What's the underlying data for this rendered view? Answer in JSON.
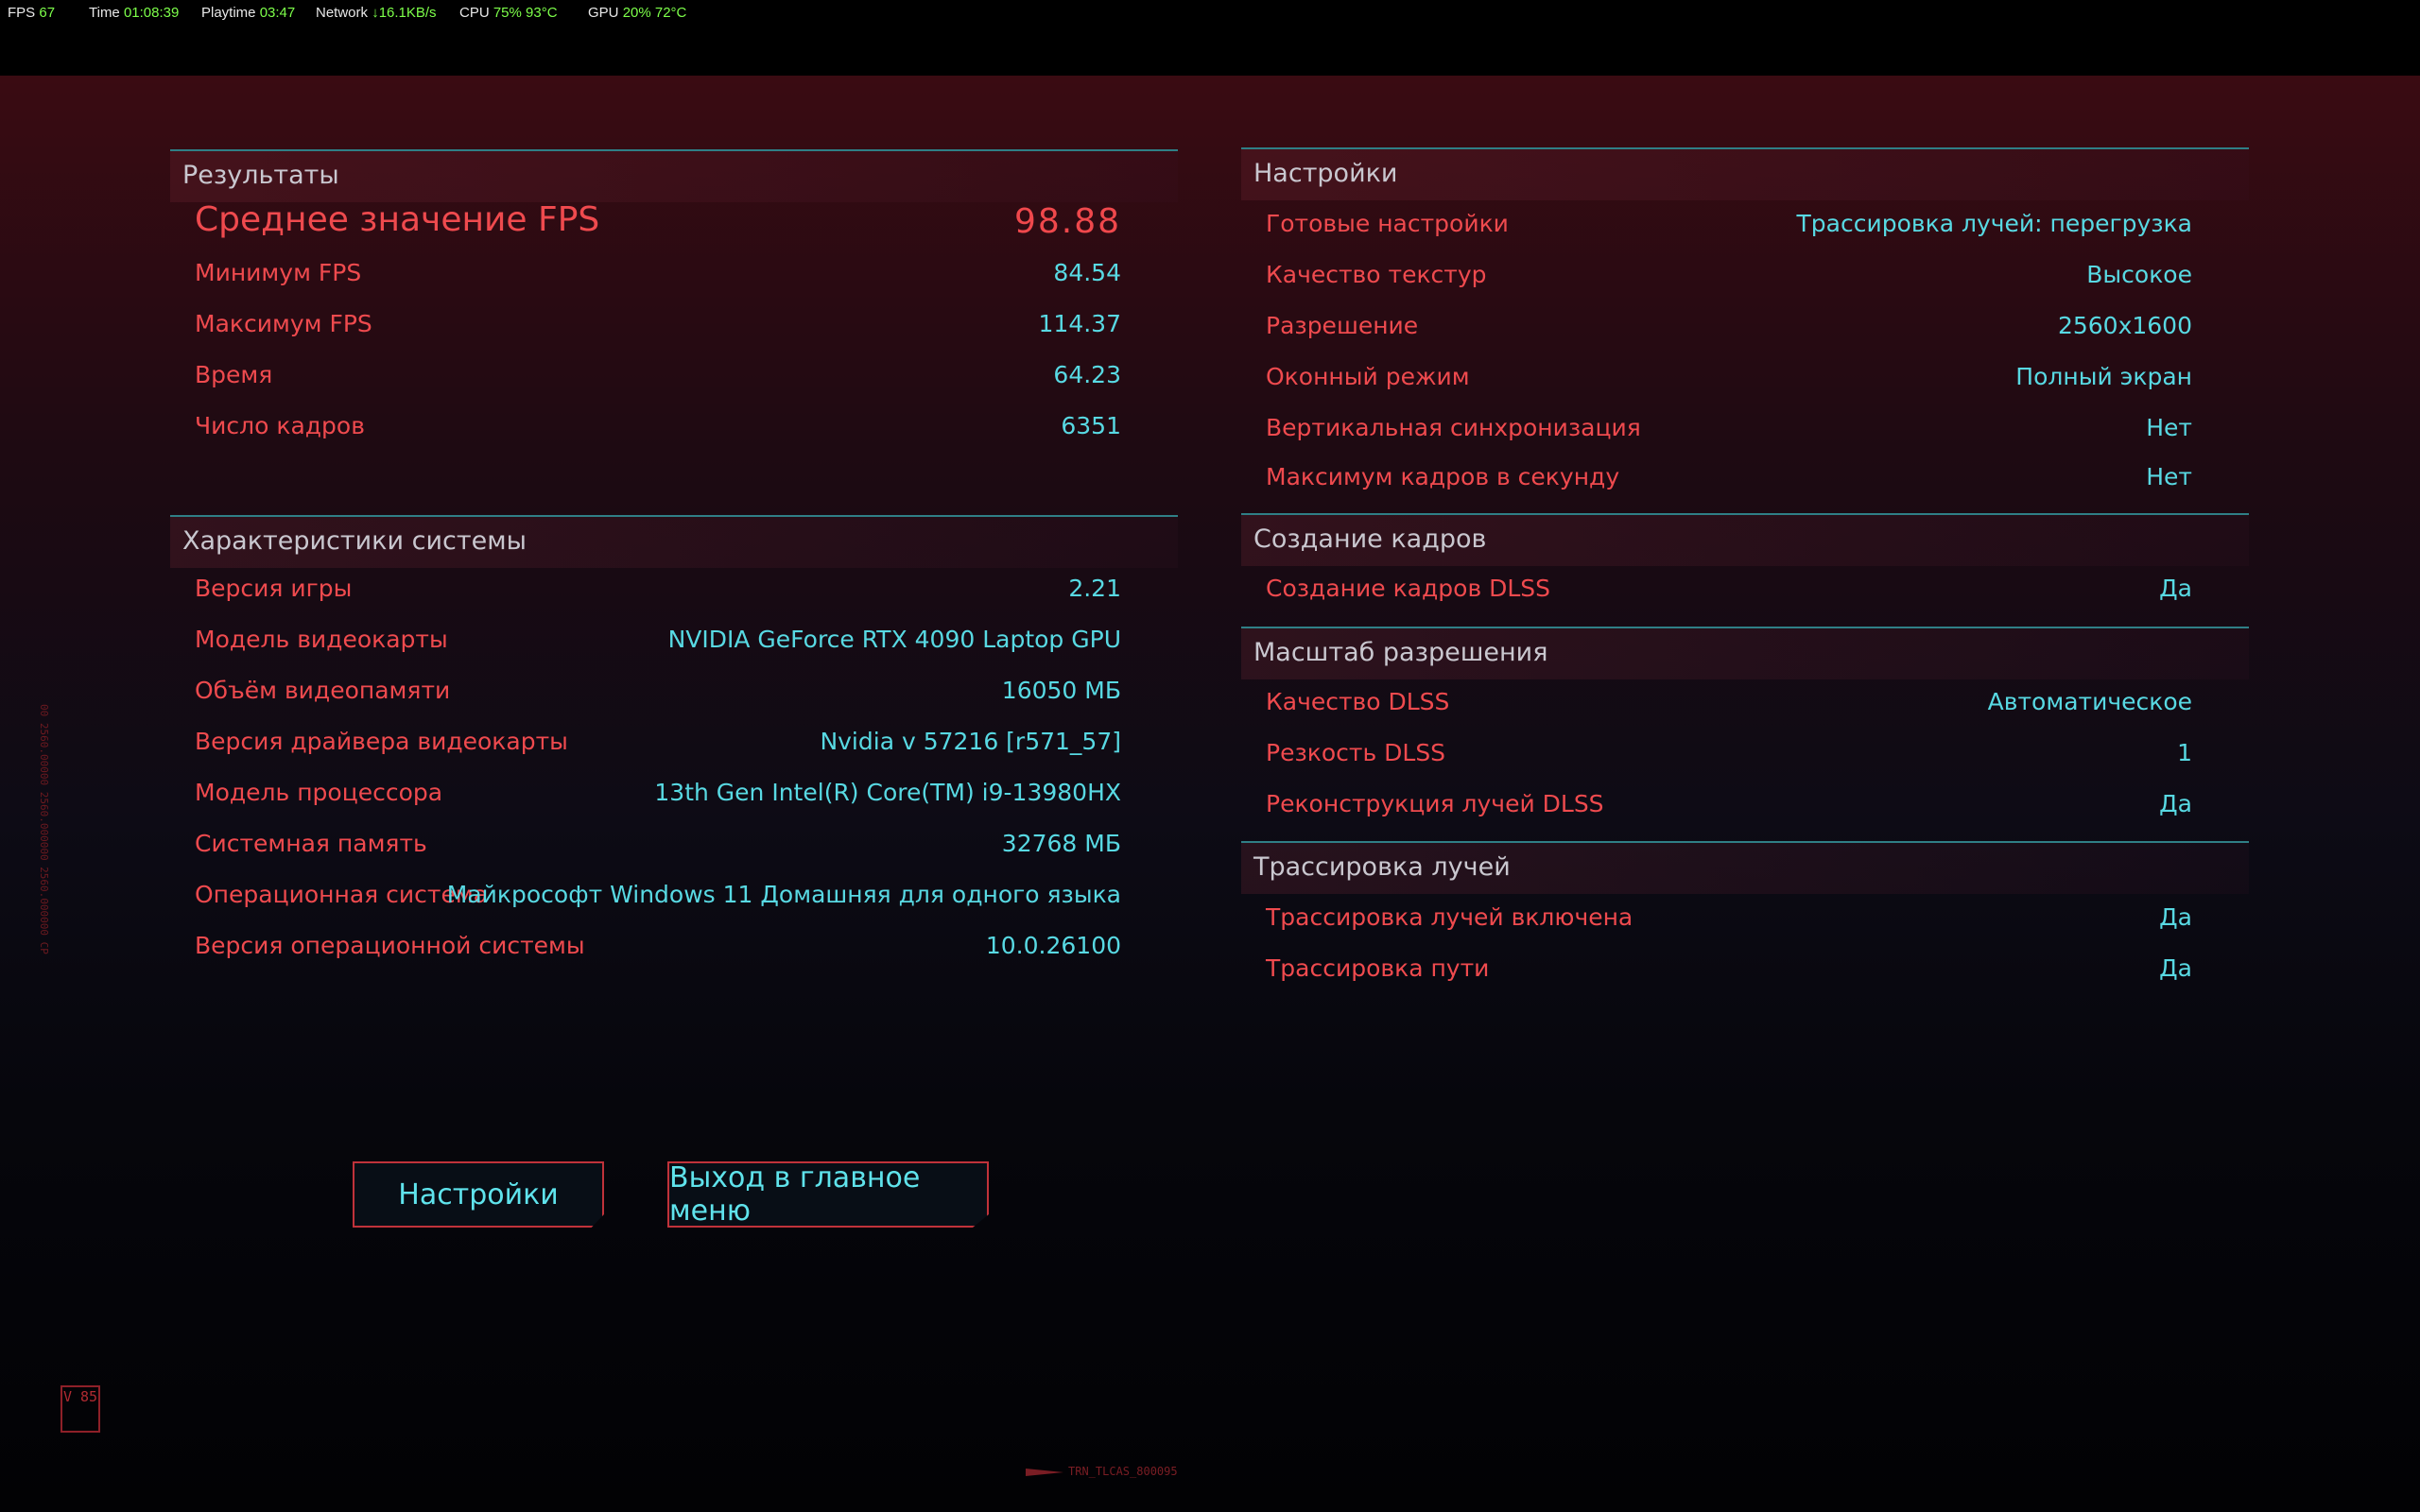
{
  "overlay": {
    "fps_label": "FPS",
    "fps_value": "67",
    "time_label": "Time",
    "time_value": "01:08:39",
    "playtime_label": "Playtime",
    "playtime_value": "03:47",
    "network_label": "Network",
    "network_value": "↓16.1KB/s",
    "cpu_label": "CPU",
    "cpu_value": "75%  93°C",
    "gpu_label": "GPU",
    "gpu_value": "20%  72°C"
  },
  "results": {
    "title": "Результаты",
    "rows": [
      {
        "label": "Среднее значение FPS",
        "value": "98.88"
      },
      {
        "label": "Минимум FPS",
        "value": "84.54"
      },
      {
        "label": "Максимум FPS",
        "value": "114.37"
      },
      {
        "label": "Время",
        "value": "64.23"
      },
      {
        "label": "Число кадров",
        "value": "6351"
      }
    ]
  },
  "system": {
    "title": "Характеристики системы",
    "rows": [
      {
        "label": "Версия игры",
        "value": "2.21"
      },
      {
        "label": "Модель видеокарты",
        "value": "NVIDIA GeForce RTX 4090 Laptop GPU"
      },
      {
        "label": "Объём видеопамяти",
        "value": "16050 МБ"
      },
      {
        "label": "Версия драйвера видеокарты",
        "value": "Nvidia v 57216 [r571_57]"
      },
      {
        "label": "Модель процессора",
        "value": "13th Gen Intel(R) Core(TM) i9-13980HX"
      },
      {
        "label": "Системная память",
        "value": "32768 МБ"
      },
      {
        "label": "Операционная система",
        "value": "Майкрософт Windows 11 Домашняя для одного языка"
      },
      {
        "label": "Версия операционной системы",
        "value": "10.0.26100"
      }
    ]
  },
  "settings": {
    "title": "Настройки",
    "rows": [
      {
        "label": "Готовые настройки",
        "value": "Трассировка лучей: перегрузка"
      },
      {
        "label": "Качество текстур",
        "value": "Высокое"
      },
      {
        "label": "Разрешение",
        "value": "2560x1600"
      },
      {
        "label": "Оконный режим",
        "value": "Полный экран"
      },
      {
        "label": "Вертикальная синхронизация",
        "value": "Нет"
      },
      {
        "label": "Максимум кадров в секунду",
        "value": "Нет"
      }
    ]
  },
  "framegen": {
    "title": "Создание кадров",
    "rows": [
      {
        "label": "Создание кадров DLSS",
        "value": "Да"
      }
    ]
  },
  "scaling": {
    "title": "Масштаб разрешения",
    "rows": [
      {
        "label": "Качество DLSS",
        "value": "Автоматическое"
      },
      {
        "label": "Резкость DLSS",
        "value": "1"
      },
      {
        "label": "Реконструкция лучей DLSS",
        "value": "Да"
      }
    ]
  },
  "raytracing": {
    "title": "Трассировка лучей",
    "rows": [
      {
        "label": "Трассировка лучей включена",
        "value": "Да"
      },
      {
        "label": "Трассировка пути",
        "value": "Да"
      }
    ]
  },
  "buttons": {
    "settings": "Настройки",
    "exit": "Выход в главное меню"
  },
  "footer": {
    "code": "TRN_TLCAS_800095",
    "logo": "V 85",
    "side_text": "00 2560.00000 2560.000000 2560.000000 CP"
  },
  "colors": {
    "label_red": "#ef4a4e",
    "value_cyan": "#58d9e3",
    "divider_teal": "#2f7f86"
  }
}
